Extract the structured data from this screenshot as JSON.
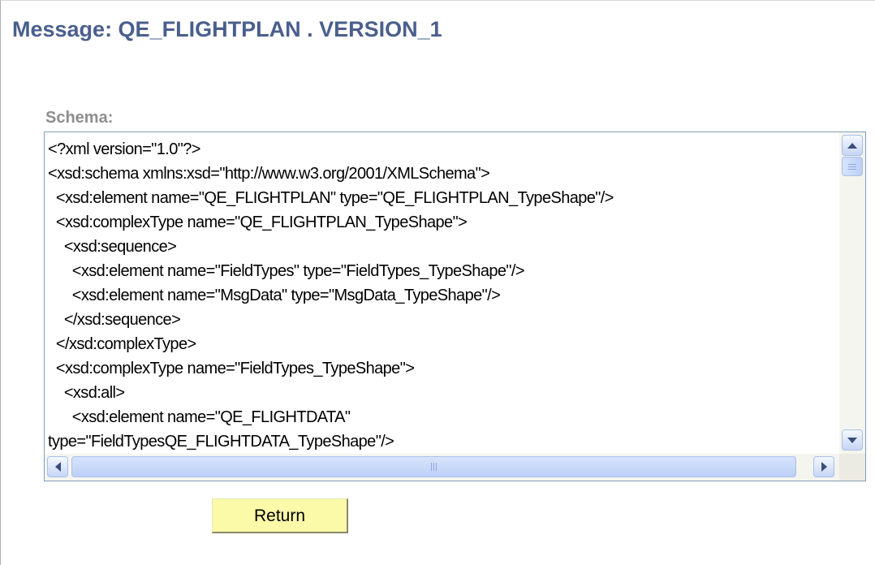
{
  "page": {
    "title": "Message: QE_FLIGHTPLAN . VERSION_1"
  },
  "schema": {
    "label": "Schema:",
    "lines": [
      "<?xml version=\"1.0\"?>",
      "<xsd:schema xmlns:xsd=\"http://www.w3.org/2001/XMLSchema\">",
      "  <xsd:element name=\"QE_FLIGHTPLAN\" type=\"QE_FLIGHTPLAN_TypeShape\"/>",
      "  <xsd:complexType name=\"QE_FLIGHTPLAN_TypeShape\">",
      "    <xsd:sequence>",
      "      <xsd:element name=\"FieldTypes\" type=\"FieldTypes_TypeShape\"/>",
      "      <xsd:element name=\"MsgData\" type=\"MsgData_TypeShape\"/>",
      "    </xsd:sequence>",
      "  </xsd:complexType>",
      "  <xsd:complexType name=\"FieldTypes_TypeShape\">",
      "    <xsd:all>",
      "      <xsd:element name=\"QE_FLIGHTDATA\"",
      "type=\"FieldTypesQE_FLIGHTDATA_TypeShape\"/>"
    ]
  },
  "scrollbars": {
    "vertical": {
      "up_icon": "chevron-up-icon",
      "down_icon": "chevron-down-icon"
    },
    "horizontal": {
      "left_icon": "chevron-left-icon",
      "right_icon": "chevron-right-icon"
    }
  },
  "actions": {
    "return_label": "Return"
  },
  "colors": {
    "title": "#4a5f8d",
    "label": "#8e8e8e",
    "button_bg": "#fafaa8",
    "scrollbar_accent": "#a9c0e8"
  }
}
